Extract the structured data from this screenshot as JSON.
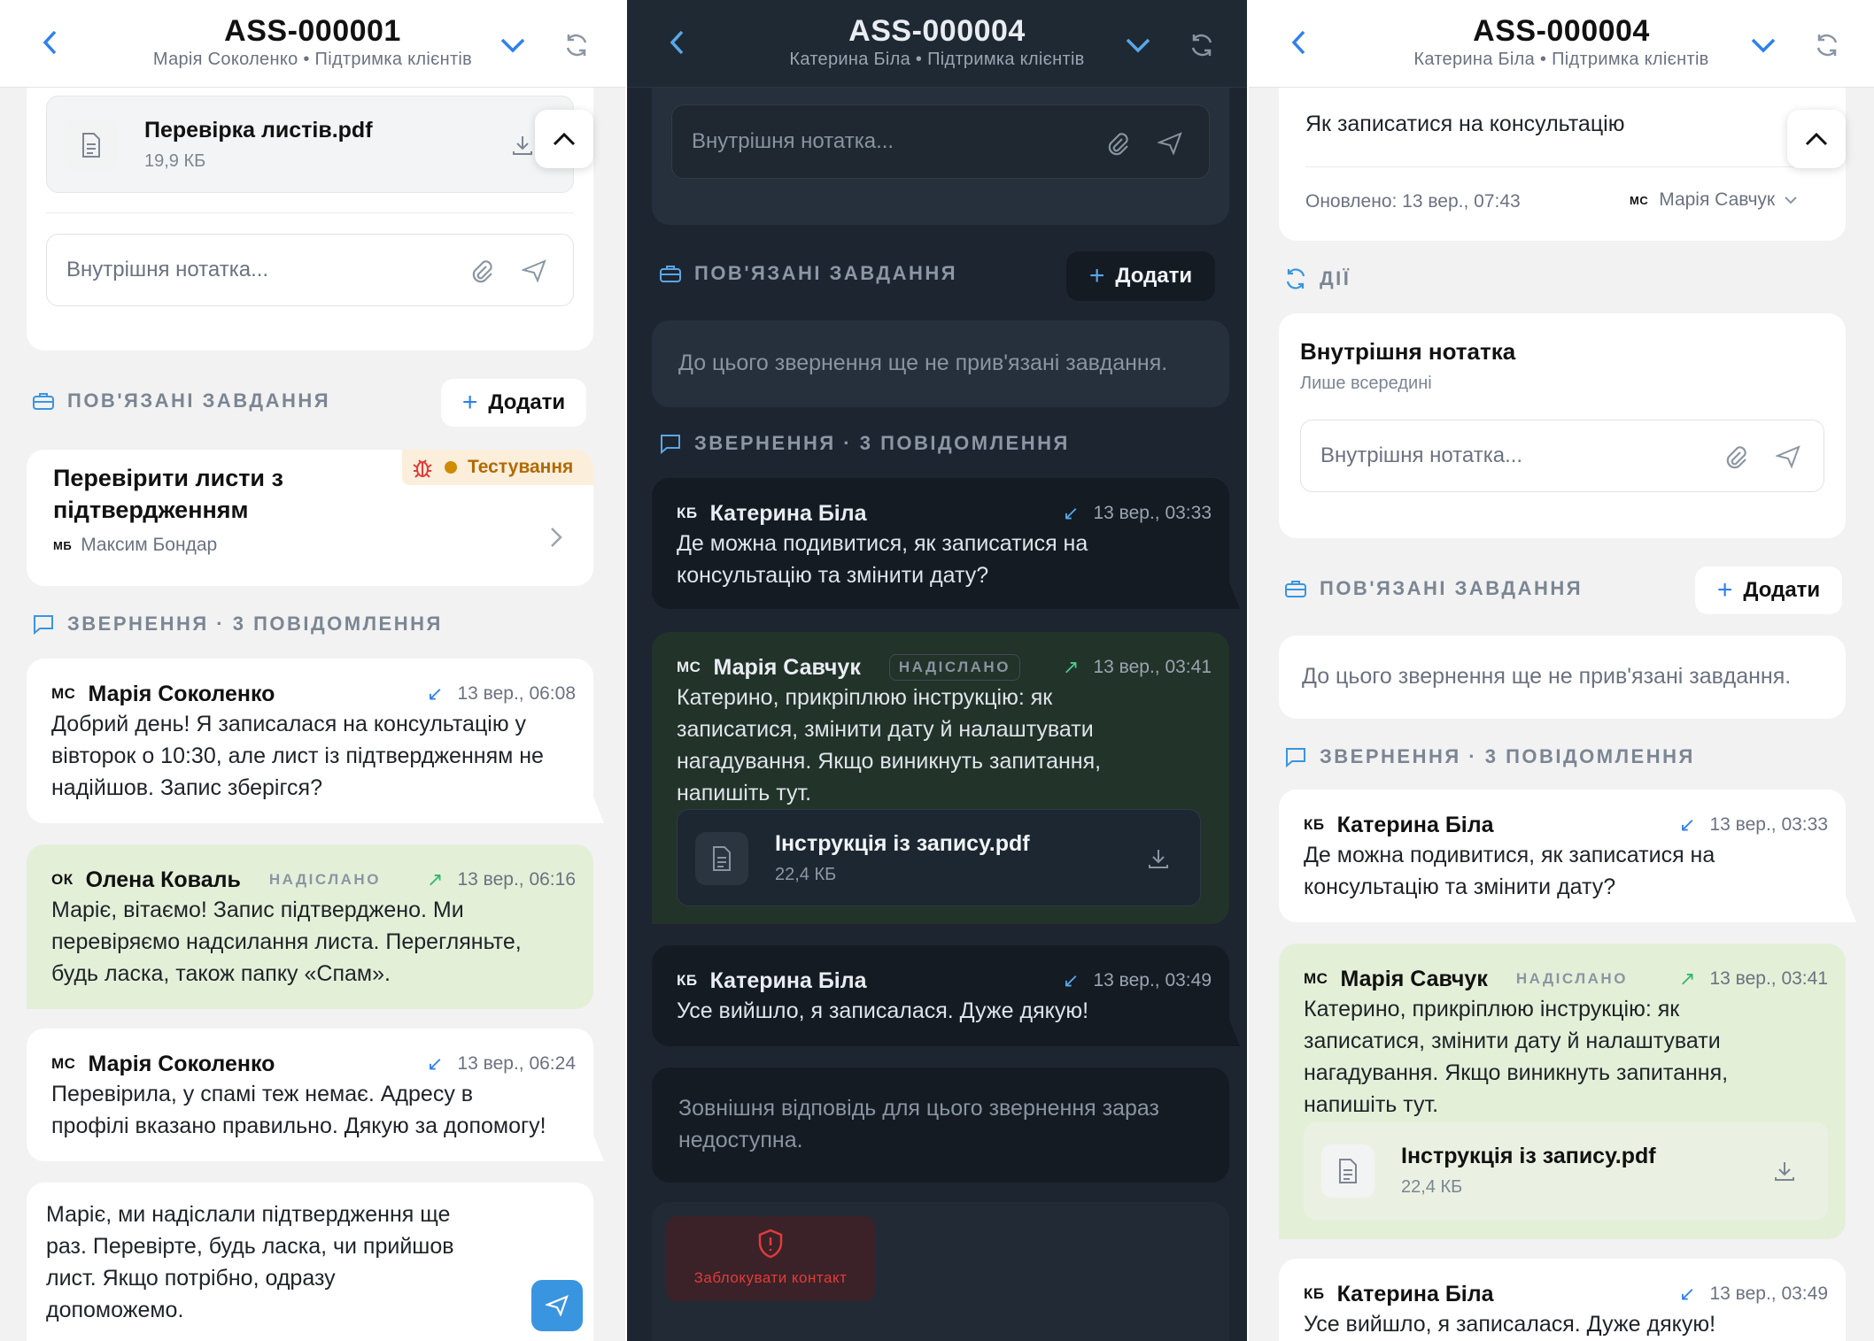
{
  "screen1": {
    "header": {
      "title": "ASS-000001",
      "subtitle": "Марія Соколенко • Підтримка клієнтів"
    },
    "attachment_top": {
      "name": "Перевірка листів.pdf",
      "size": "19,9 КБ"
    },
    "note_placeholder": "Внутрішня нотатка...",
    "tasks_section": {
      "label": "ПОВ'ЯЗАНІ ЗАВДАННЯ",
      "add_label": "Додати"
    },
    "task": {
      "title_line1": "Перевірити листи з",
      "title_line2": "підтвердженням",
      "status": "Тестування",
      "assignee_initials": "МБ",
      "assignee": "Максим Бондар"
    },
    "messages_section": {
      "label": "ЗВЕРНЕННЯ · 3 ПОВІДОМЛЕННЯ"
    },
    "messages": [
      {
        "initials": "МС",
        "name": "Марія Соколенко",
        "time": "13 вер., 06:08",
        "lines": [
          "Добрий день! Я записалася на консультацію у",
          "вівторок о 10:30, але лист із підтвердженням не",
          "надійшов. Запис зберігся?"
        ]
      },
      {
        "initials": "ОК",
        "name": "Олена Коваль",
        "status": "НАДІСЛАНО",
        "time": "13 вер., 06:16",
        "lines": [
          "Маріє, вітаємо! Запис підтверджено. Ми",
          "перевіряємо надсилання листа. Перегляньте,",
          "будь ласка, також папку «Спам»."
        ]
      },
      {
        "initials": "МС",
        "name": "Марія Соколенко",
        "time": "13 вер., 06:24",
        "lines": [
          "Перевірила, у спамі теж немає. Адресу в",
          "профілі вказано правильно. Дякую за допомогу!"
        ]
      }
    ],
    "composer_lines": [
      "Маріє, ми надіслали підтвердження ще",
      "раз. Перевірте, будь ласка, чи прийшов",
      "лист. Якщо потрібно, одразу",
      "допоможемо."
    ]
  },
  "screen2": {
    "header": {
      "title": "ASS-000004",
      "subtitle": "Катерина Біла • Підтримка клієнтів"
    },
    "note_placeholder": "Внутрішня нотатка...",
    "tasks_section": {
      "label": "ПОВ'ЯЗАНІ ЗАВДАННЯ",
      "add_label": "Додати"
    },
    "no_tasks": "До цього звернення ще не прив'язані завдання.",
    "messages_section": {
      "label": "ЗВЕРНЕННЯ · 3 ПОВІДОМЛЕННЯ"
    },
    "messages": [
      {
        "initials": "КБ",
        "name": "Катерина Біла",
        "time": "13 вер., 03:33",
        "lines": [
          "Де можна подивитися, як записатися на",
          "консультацію та змінити дату?"
        ]
      },
      {
        "initials": "МС",
        "name": "Марія Савчук",
        "status": "НАДІСЛАНО",
        "time": "13 вер., 03:41",
        "lines": [
          "Катерино, прикріплюю інструкцію: як",
          "записатися, змінити дату й налаштувати",
          "нагадування. Якщо виникнуть запитання,",
          "напишіть тут."
        ],
        "attachment": {
          "name": "Інструкція із запису.pdf",
          "size": "22,4 КБ"
        }
      },
      {
        "initials": "КБ",
        "name": "Катерина Біла",
        "time": "13 вер., 03:49",
        "lines": [
          "Усе вийшло, я записалася. Дуже дякую!"
        ]
      }
    ],
    "external_unavailable": [
      "Зовнішня відповідь для цього звернення зараз",
      "недоступна."
    ],
    "block_contact": "Заблокувати контакт"
  },
  "screen3": {
    "header": {
      "title": "ASS-000004",
      "subtitle": "Катерина Біла • Підтримка клієнтів"
    },
    "topic": "Як записатися на консультацію",
    "updated": "Оновлено: 13 вер., 07:43",
    "owner_initials": "МС",
    "owner": "Марія Савчук",
    "actions_label": "ДІЇ",
    "internal_note": {
      "title": "Внутрішня нотатка",
      "subtitle": "Лише всередині",
      "placeholder": "Внутрішня нотатка..."
    },
    "tasks_section": {
      "label": "ПОВ'ЯЗАНІ ЗАВДАННЯ",
      "add_label": "Додати"
    },
    "no_tasks": "До цього звернення ще не прив'язані завдання.",
    "messages_section": {
      "label": "ЗВЕРНЕННЯ · 3 ПОВІДОМЛЕННЯ"
    },
    "messages": [
      {
        "initials": "КБ",
        "name": "Катерина Біла",
        "time": "13 вер., 03:33",
        "lines": [
          "Де можна подивитися, як записатися на",
          "консультацію та змінити дату?"
        ]
      },
      {
        "initials": "МС",
        "name": "Марія Савчук",
        "status": "НАДІСЛАНО",
        "time": "13 вер., 03:41",
        "lines": [
          "Катерино, прикріплюю інструкцію: як",
          "записатися, змінити дату й налаштувати",
          "нагадування. Якщо виникнуть запитання,",
          "напишіть тут."
        ],
        "attachment": {
          "name": "Інструкція із запису.pdf",
          "size": "22,4 КБ"
        }
      },
      {
        "initials": "КБ",
        "name": "Катерина Біла",
        "time": "13 вер., 03:49",
        "lines": [
          "Усе вийшло, я записалася. Дуже дякую!"
        ]
      }
    ]
  },
  "colors": {
    "accent": "#2f80ed",
    "sent_bg": "#e4efd8",
    "sent_bg_dark": "#22332a",
    "danger": "#e23b3b",
    "status_orange": "#d18b00"
  }
}
